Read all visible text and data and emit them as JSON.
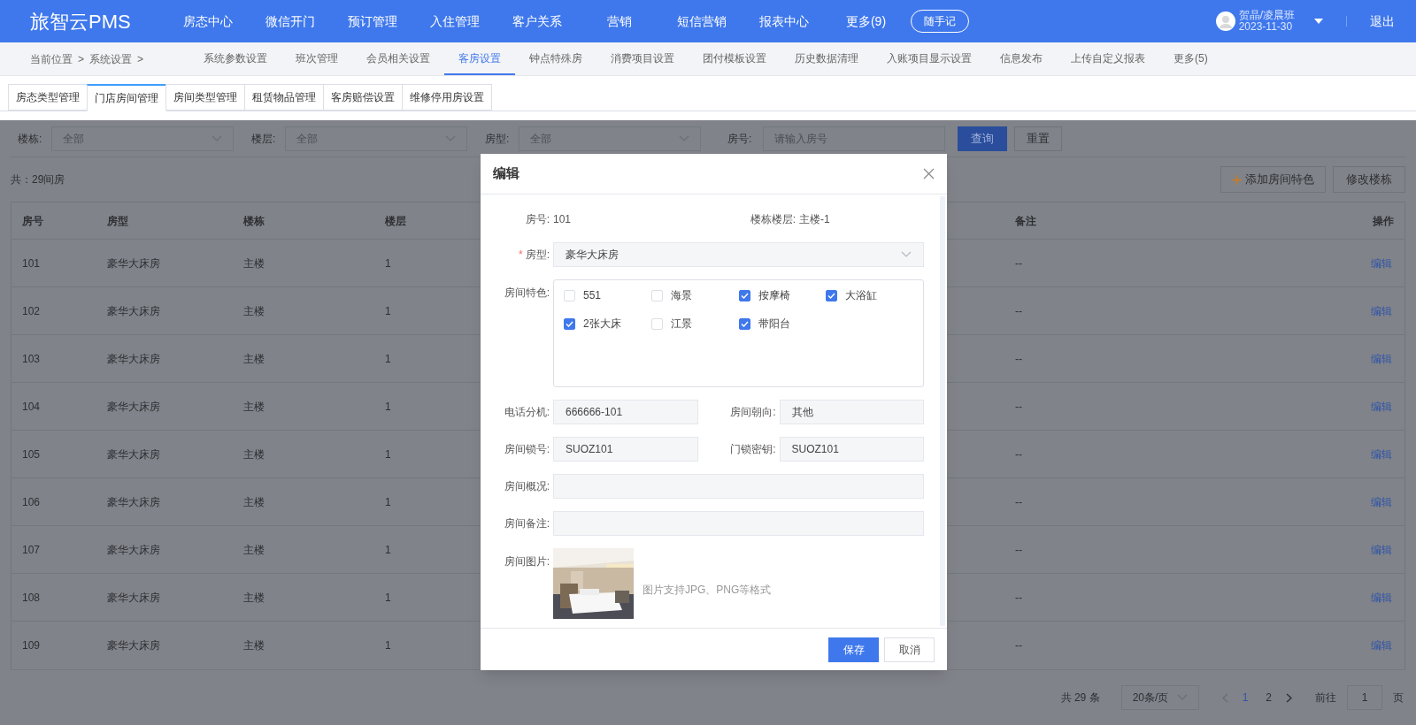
{
  "header": {
    "logo": "旅智云PMS",
    "nav": [
      {
        "label": "房态中心",
        "selected": false
      },
      {
        "label": "微信开门",
        "selected": false
      },
      {
        "label": "预订管理",
        "selected": false
      },
      {
        "label": "入住管理",
        "selected": false
      },
      {
        "label": "客户关系",
        "selected": false
      },
      {
        "label": "营销",
        "selected": false
      },
      {
        "label": "短信营销",
        "selected": false
      },
      {
        "label": "报表中心",
        "selected": false
      },
      {
        "label": "更多(9)",
        "selected": false
      }
    ],
    "memo_button": "随手记",
    "user": "贺晶/凌晨班",
    "date": "2023-11-30",
    "logout": "退出"
  },
  "breadcrumb": [
    "当前位置",
    "系统设置"
  ],
  "breadcrumb_sep": ">",
  "sub_nav": [
    {
      "label": "系统参数设置",
      "selected": false
    },
    {
      "label": "班次管理",
      "selected": false
    },
    {
      "label": "会员相关设置",
      "selected": false
    },
    {
      "label": "客房设置",
      "selected": true
    },
    {
      "label": "钟点特殊房",
      "selected": false
    },
    {
      "label": "消费项目设置",
      "selected": false
    },
    {
      "label": "团付模板设置",
      "selected": false
    },
    {
      "label": "历史数据清理",
      "selected": false
    },
    {
      "label": "入账项目显示设置",
      "selected": false
    },
    {
      "label": "信息发布",
      "selected": false
    },
    {
      "label": "上传自定义报表",
      "selected": false
    },
    {
      "label": "更多(5)",
      "selected": false
    }
  ],
  "tabs": [
    {
      "label": "房态类型管理",
      "selected": false
    },
    {
      "label": "门店房间管理",
      "selected": true
    },
    {
      "label": "房间类型管理",
      "selected": false
    },
    {
      "label": "租赁物品管理",
      "selected": false
    },
    {
      "label": "客房赔偿设置",
      "selected": false
    },
    {
      "label": "维修停用房设置",
      "selected": false
    }
  ],
  "filters": [
    {
      "label": "楼栋:",
      "value": "全部"
    },
    {
      "label": "楼层:",
      "value": "全部"
    },
    {
      "label": "房型:",
      "value": "全部"
    }
  ],
  "room_search": {
    "label": "房号:",
    "placeholder": "请输入房号"
  },
  "query_button": "查询",
  "reset_button": "重置",
  "total": "共：29间房",
  "add_feature_button": "添加房间特色",
  "edit_building_button": "修改楼栋",
  "table": {
    "columns": [
      "房号",
      "房型",
      "楼栋",
      "楼层",
      "备注",
      "操作"
    ],
    "rows": [
      {
        "cells": [
          "101",
          "豪华大床房",
          "主楼",
          "1",
          "--"
        ],
        "action": "编辑"
      },
      {
        "cells": [
          "102",
          "豪华大床房",
          "主楼",
          "1",
          "--"
        ],
        "action": "编辑"
      },
      {
        "cells": [
          "103",
          "豪华大床房",
          "主楼",
          "1",
          "--"
        ],
        "action": "编辑"
      },
      {
        "cells": [
          "104",
          "豪华大床房",
          "主楼",
          "1",
          "--"
        ],
        "action": "编辑"
      },
      {
        "cells": [
          "105",
          "豪华大床房",
          "主楼",
          "1",
          "--"
        ],
        "action": "编辑"
      },
      {
        "cells": [
          "106",
          "豪华大床房",
          "主楼",
          "1",
          "--"
        ],
        "action": "编辑"
      },
      {
        "cells": [
          "107",
          "豪华大床房",
          "主楼",
          "1",
          "--"
        ],
        "action": "编辑"
      },
      {
        "cells": [
          "108",
          "豪华大床房",
          "主楼",
          "1",
          "--"
        ],
        "action": "编辑"
      },
      {
        "cells": [
          "109",
          "豪华大床房",
          "主楼",
          "1",
          "--"
        ],
        "action": "编辑"
      }
    ]
  },
  "pagination": {
    "total": "共 29 条",
    "page_size": "20条/页",
    "pages": [
      {
        "label": "1",
        "selected": true
      },
      {
        "label": "2",
        "selected": false
      }
    ],
    "goto_label": "前往",
    "goto_value": "1",
    "goto_suffix": "页"
  },
  "dialog": {
    "title": "编辑",
    "room_label": "房号:",
    "room_value": "101",
    "floor_label": "楼栋楼层:",
    "floor_value": "主楼-1",
    "type_label": "房型:",
    "required_mark": "*",
    "type_value": "豪华大床房",
    "features_label": "房间特色:",
    "features": [
      {
        "label": "551",
        "checked": false
      },
      {
        "label": "海景",
        "checked": false
      },
      {
        "label": "按摩椅",
        "checked": true
      },
      {
        "label": "大浴缸",
        "checked": true
      },
      {
        "label": "2张大床",
        "checked": true
      },
      {
        "label": "江景",
        "checked": false
      },
      {
        "label": "带阳台",
        "checked": true
      }
    ],
    "fields": [
      {
        "label": "电话分机:",
        "value": "666666-101"
      },
      {
        "label": "房间朝向:",
        "value": "其他"
      },
      {
        "label": "房间锁号:",
        "value": "SUOZ101"
      },
      {
        "label": "门锁密钥:",
        "value": "SUOZ101"
      }
    ],
    "wide_fields": [
      {
        "label": "房间概况:"
      },
      {
        "label": "房间备注:"
      }
    ],
    "picture_label": "房间图片:",
    "picture_hint": "图片支持JPG、PNG等格式",
    "save": "保存",
    "cancel": "取消"
  }
}
